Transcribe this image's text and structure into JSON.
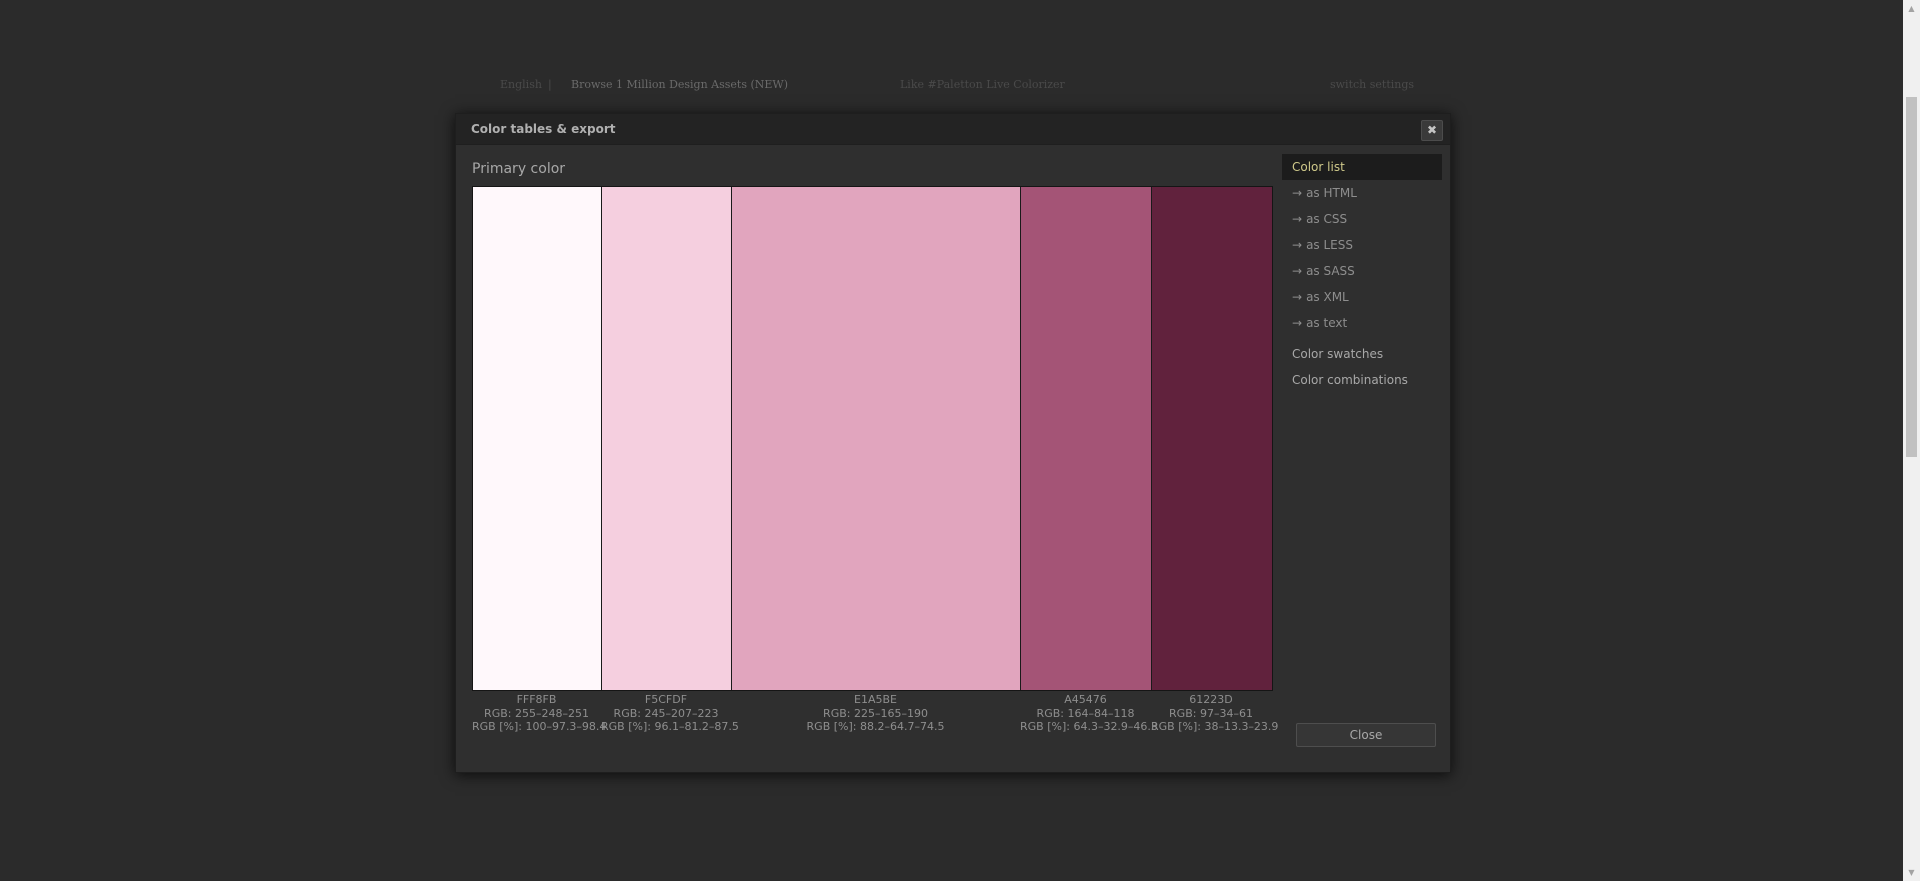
{
  "background_nav": {
    "language": "English",
    "separator": "|",
    "browse": "Browse 1 Million Design Assets (NEW)",
    "like": "Like #Paletton Live Colorizer",
    "settings": "switch settings"
  },
  "dialog": {
    "title": "Color tables & export",
    "close_glyph": "✖",
    "section_title": "Primary color",
    "swatches": [
      {
        "hex": "FFF8FB",
        "color": "#FFF8FB",
        "rgb": "RGB: 255–248–251",
        "rgb_pct": "RGB [%]: 100–97.3–98.4"
      },
      {
        "hex": "F5CFDF",
        "color": "#F5CFDF",
        "rgb": "RGB: 245–207–223",
        "rgb_pct": "RGB [%]: 96.1–81.2–87.5"
      },
      {
        "hex": "E1A5BE",
        "color": "#E1A5BE",
        "rgb": "RGB: 225–165–190",
        "rgb_pct": "RGB [%]: 88.2–64.7–74.5"
      },
      {
        "hex": "A45476",
        "color": "#A45476",
        "rgb": "RGB: 164–84–118",
        "rgb_pct": "RGB [%]: 64.3–32.9–46.3"
      },
      {
        "hex": "61223D",
        "color": "#61223D",
        "rgb": "RGB: 97–34–61",
        "rgb_pct": "RGB [%]: 38–13.3–23.9"
      }
    ],
    "sidebar": {
      "color_list": "Color list",
      "arrow": "→",
      "as_html": "as HTML",
      "as_css": "as CSS",
      "as_less": "as LESS",
      "as_sass": "as SASS",
      "as_xml": "as XML",
      "as_text": "as text",
      "color_swatches": "Color swatches",
      "color_combinations": "Color combinations"
    },
    "close_button": "Close"
  },
  "colors": {
    "page_bg": "#2b2b2b",
    "dialog_bg": "#2f2f2f",
    "active_item_text": "#cfc98a"
  }
}
